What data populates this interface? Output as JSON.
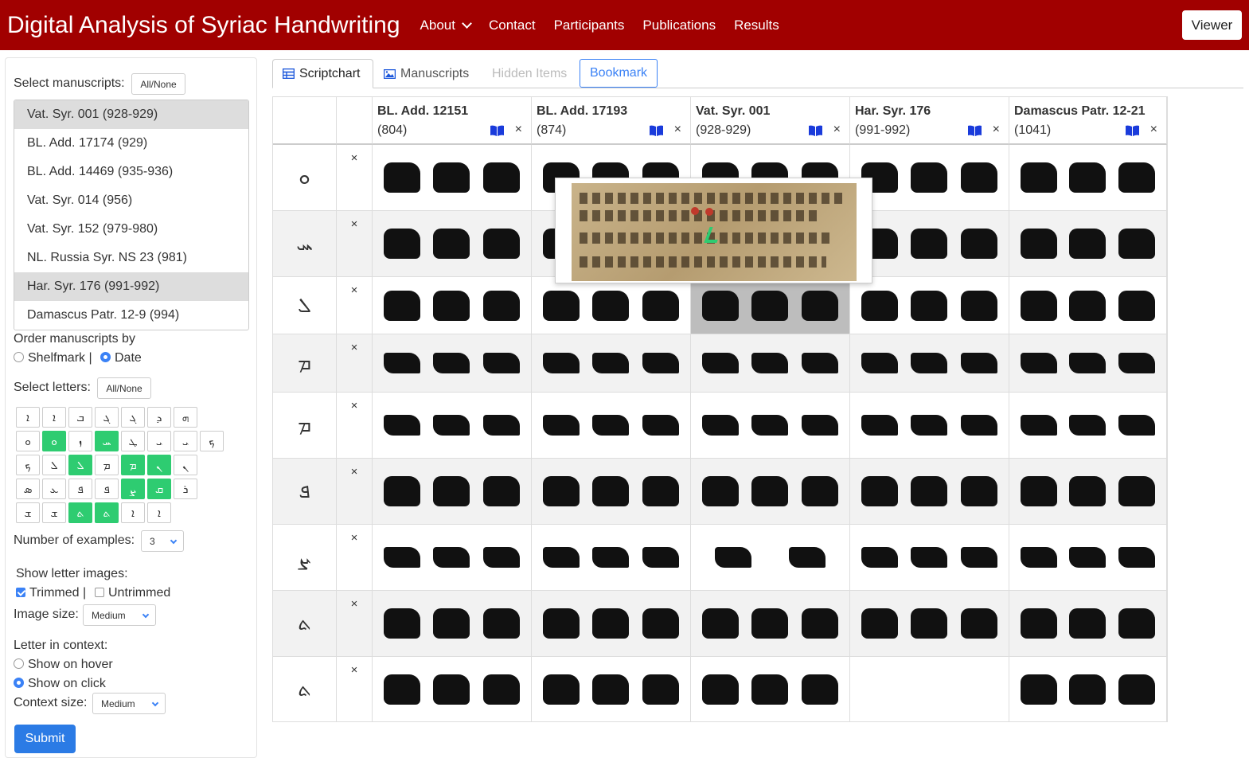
{
  "navbar": {
    "brand": "Digital Analysis of Syriac Handwriting",
    "links": [
      "About",
      "Contact",
      "Participants",
      "Publications",
      "Results"
    ],
    "viewer": "Viewer"
  },
  "sidebar": {
    "select_manuscripts_label": "Select manuscripts:",
    "all_none": "All/None",
    "manuscripts": [
      {
        "label": "Vat. Syr. 001 (928-929)",
        "selected": true
      },
      {
        "label": "BL. Add. 17174 (929)",
        "selected": false
      },
      {
        "label": "BL. Add. 14469 (935-936)",
        "selected": false
      },
      {
        "label": "Vat. Syr. 014 (956)",
        "selected": false
      },
      {
        "label": "Vat. Syr. 152 (979-980)",
        "selected": false
      },
      {
        "label": "NL. Russia Syr. NS 23 (981)",
        "selected": false
      },
      {
        "label": "Har. Syr. 176 (991-992)",
        "selected": true
      },
      {
        "label": "Damascus Patr. 12-9 (994)",
        "selected": false
      }
    ],
    "order_label": "Order manuscripts by",
    "order_shelfmark": "Shelfmark |",
    "order_date": "Date",
    "select_letters_label": "Select letters:",
    "letters_all_none": "All/None",
    "letter_rows": [
      [
        {
          "g": "ܐ",
          "on": false
        },
        {
          "g": "ܐ",
          "on": false
        },
        {
          "g": "ܒ",
          "on": false
        },
        {
          "g": "ܓ",
          "on": false
        },
        {
          "g": "ܓ",
          "on": false
        },
        {
          "g": "ܕ",
          "on": false
        },
        {
          "g": "ܗ",
          "on": false
        }
      ],
      [
        {
          "g": "ܘ",
          "on": false
        },
        {
          "g": "ܘ",
          "on": true
        },
        {
          "g": "ܙ",
          "on": false
        },
        {
          "g": "ܚ",
          "on": true
        },
        {
          "g": "ܛ",
          "on": false
        },
        {
          "g": "ܝ",
          "on": false
        },
        {
          "g": "ܝ",
          "on": false
        },
        {
          "g": "ܟ",
          "on": false
        }
      ],
      [
        {
          "g": "ܟ",
          "on": false
        },
        {
          "g": "ܠ",
          "on": false
        },
        {
          "g": "ܠ",
          "on": true
        },
        {
          "g": "ܡ",
          "on": false
        },
        {
          "g": "ܡ",
          "on": true
        },
        {
          "g": "ܢ",
          "on": true
        },
        {
          "g": "ܢ",
          "on": false
        }
      ],
      [
        {
          "g": "ܣ",
          "on": false
        },
        {
          "g": "ܥ",
          "on": false
        },
        {
          "g": "ܦ",
          "on": false
        },
        {
          "g": "ܦ",
          "on": false
        },
        {
          "g": "ܨ",
          "on": true
        },
        {
          "g": "ܩ",
          "on": true
        },
        {
          "g": "ܪ",
          "on": false
        }
      ],
      [
        {
          "g": "ܫ",
          "on": false
        },
        {
          "g": "ܫ",
          "on": false
        },
        {
          "g": "ܬ",
          "on": true
        },
        {
          "g": "ܬ",
          "on": true
        },
        {
          "g": "ܐ",
          "on": false
        },
        {
          "g": "ܐ",
          "on": false
        }
      ]
    ],
    "num_examples_label": "Number of examples:",
    "num_examples_value": "3",
    "show_images_label": "Show letter images:",
    "trimmed": "Trimmed |",
    "untrimmed": "Untrimmed",
    "image_size_label": "Image size:",
    "image_size_value": "Medium",
    "context_label": "Letter in context:",
    "show_hover": "Show on hover",
    "show_click": "Show on click",
    "context_size_label": "Context size:",
    "context_size_value": "Medium",
    "submit": "Submit"
  },
  "tabs": {
    "scriptchart": "Scriptchart",
    "manuscripts": "Manuscripts",
    "hidden": "Hidden Items",
    "bookmark": "Bookmark"
  },
  "table": {
    "columns": [
      {
        "name": "BL. Add. 12151",
        "date": "(804)"
      },
      {
        "name": "BL. Add. 17193",
        "date": "(874)"
      },
      {
        "name": "Vat. Syr. 001",
        "date": "(928-929)"
      },
      {
        "name": "Har. Syr. 176",
        "date": "(991-992)"
      },
      {
        "name": "Damascus Patr. 12-21",
        "date": "(1041)"
      }
    ],
    "remove_glyph": "×",
    "rows": [
      "ܘ",
      "ܚ",
      "ܠ",
      "ܡ",
      "ܡ",
      "ܦ",
      "ܨ",
      "ܬ",
      "ܬ"
    ]
  },
  "colors": {
    "navbar": "#a10000",
    "selected_letter": "#2ecc71",
    "accent": "#3b82f6"
  }
}
